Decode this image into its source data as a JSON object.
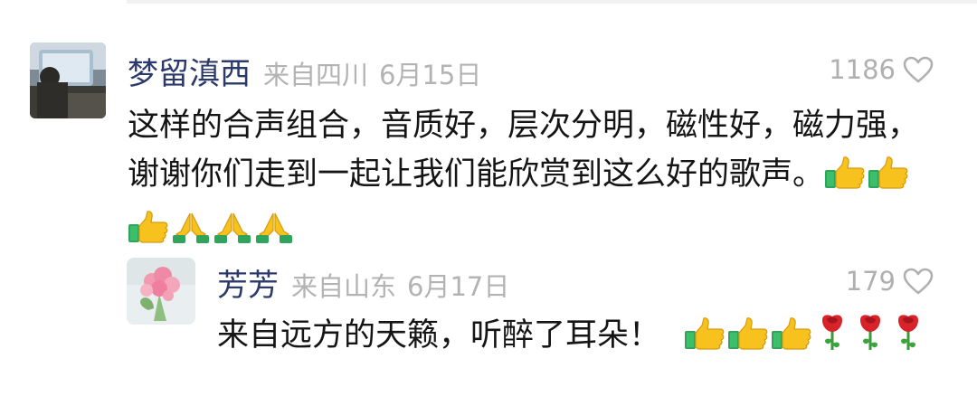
{
  "comments": [
    {
      "username": "梦留滇西",
      "origin": "来自四川",
      "date": "6月15日",
      "likes": "1186",
      "text": "这样的合声组合，音质好，层次分明，磁性好，磁力强，谢谢你们走到一起让我们能欣赏到这么好的歌声。",
      "emojis": [
        "thumbs-up",
        "thumbs-up",
        "thumbs-up",
        "praying-hands",
        "praying-hands",
        "praying-hands"
      ]
    }
  ],
  "reply": {
    "username": "芳芳",
    "origin": "来自山东",
    "date": "6月17日",
    "likes": "179",
    "text": "来自远方的天籁，听醉了耳朵！",
    "emojis": [
      "thumbs-up",
      "thumbs-up",
      "thumbs-up",
      "rose",
      "rose",
      "rose"
    ]
  },
  "icons": {
    "like": "heart-outline-icon",
    "thumbs_up": "thumbs-up-emoji",
    "praying_hands": "praying-hands-emoji",
    "rose": "rose-emoji"
  },
  "colors": {
    "username": "#2b3a6a",
    "meta_gray": "#b3b3b3",
    "text": "#151515",
    "thumbs_yellow": "#f7c21d",
    "sleeve_green": "#2fa45a",
    "rose_red": "#d8232a"
  }
}
